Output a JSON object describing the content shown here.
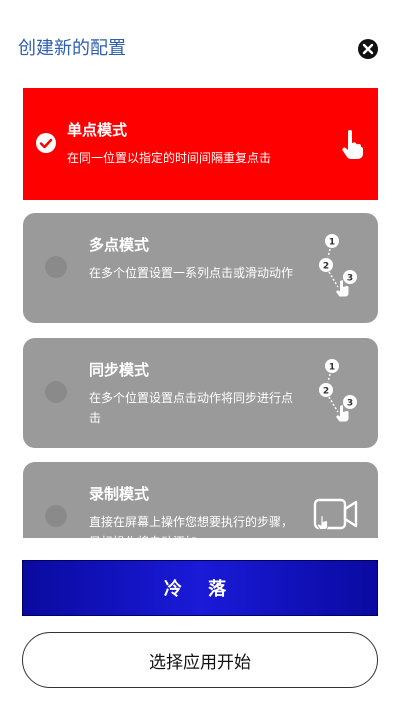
{
  "header": {
    "title": "创建新的配置",
    "close_icon": "close-icon"
  },
  "modes": [
    {
      "title": "单点模式",
      "description": "在同一位置以指定的时间间隔重复点击",
      "selected": true,
      "icon": "tap-hand-icon",
      "color": "#ff0000"
    },
    {
      "title": "多点模式",
      "description": "在多个位置设置一系列点击或滑动动作",
      "selected": false,
      "icon": "multi-tap-icon",
      "color": "#9a9a9a"
    },
    {
      "title": "同步模式",
      "description": "在多个位置设置点击动作将同步进行点击",
      "selected": false,
      "icon": "sync-tap-icon",
      "color": "#9a9a9a"
    },
    {
      "title": "录制模式",
      "description": "直接在屏幕上操作您想要执行的步骤，目标操作将自动添加",
      "selected": false,
      "icon": "record-video-icon",
      "color": "#9a9a9a"
    }
  ],
  "buttons": {
    "cooldown": "冷 落",
    "start": "选择应用开始"
  },
  "colors": {
    "accent": "#2f5fb0",
    "selected": "#ff0000",
    "unselected": "#9a9a9a",
    "primary_button": "#1414c8"
  }
}
